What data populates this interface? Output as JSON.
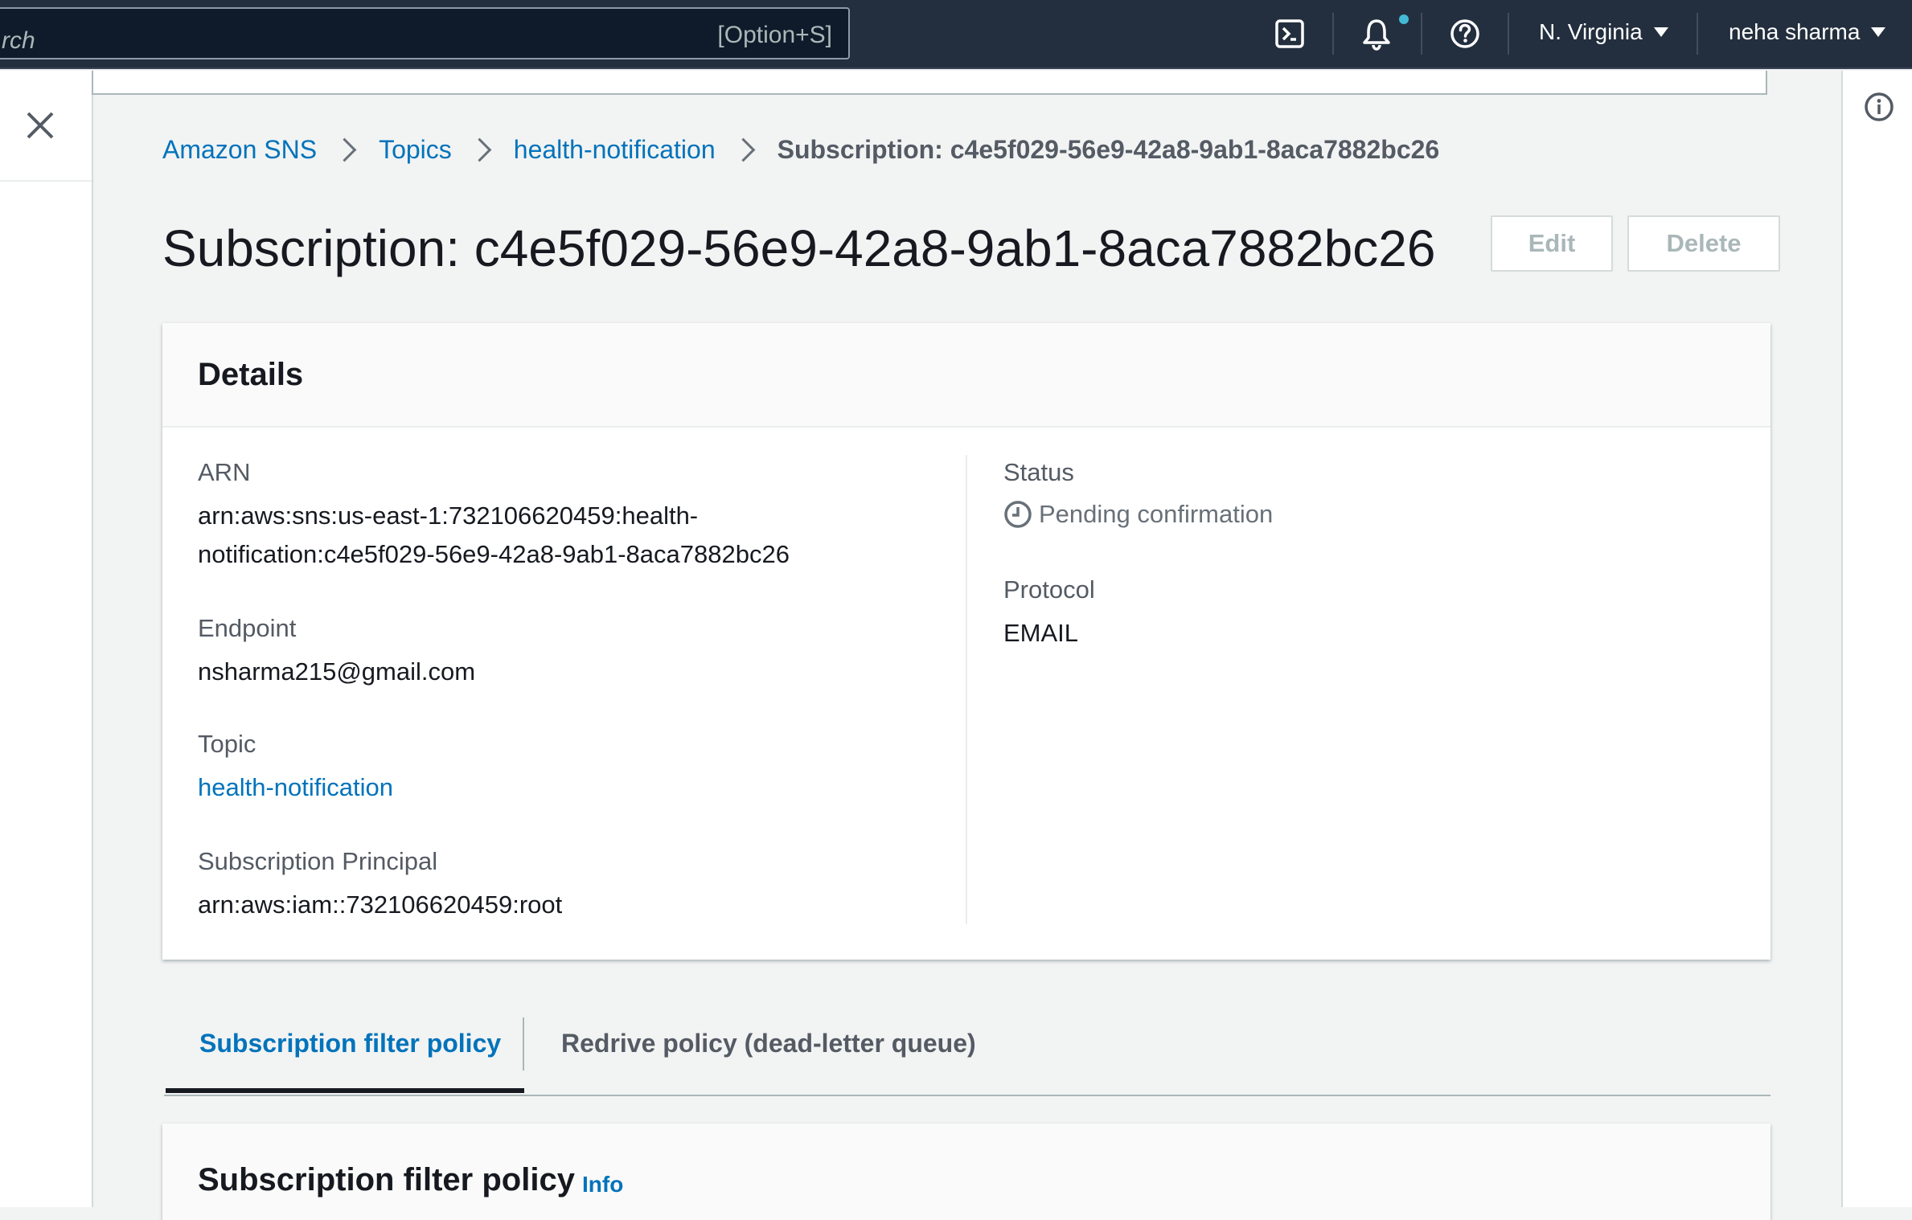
{
  "topnav": {
    "search_value": "rch",
    "search_shortcut": "[Option+S]",
    "region": "N. Virginia",
    "user": "neha sharma",
    "icons": [
      "cloudshell-icon",
      "bell-icon",
      "help-icon"
    ],
    "notification_dot_color": "#44b9d6"
  },
  "breadcrumb": {
    "items": [
      "Amazon SNS",
      "Topics",
      "health-notification"
    ],
    "current": "Subscription: c4e5f029-56e9-42a8-9ab1-8aca7882bc26"
  },
  "page": {
    "title": "Subscription: c4e5f029-56e9-42a8-9ab1-8aca7882bc26",
    "edit_label": "Edit",
    "delete_label": "Delete"
  },
  "details": {
    "heading": "Details",
    "arn_label": "ARN",
    "arn_line1": "arn:aws:sns:us-east-1:732106620459:health-",
    "arn_line2": "notification:c4e5f029-56e9-42a8-9ab1-8aca7882bc26",
    "endpoint_label": "Endpoint",
    "endpoint_value": "nsharma215@gmail.com",
    "topic_label": "Topic",
    "topic_value": "health-notification",
    "principal_label": "Subscription Principal",
    "principal_value": "arn:aws:iam::732106620459:root",
    "status_label": "Status",
    "status_value": "Pending confirmation",
    "protocol_label": "Protocol",
    "protocol_value": "EMAIL"
  },
  "tabs": {
    "items": [
      "Subscription filter policy",
      "Redrive policy (dead-letter queue)"
    ],
    "active": "Subscription filter policy"
  },
  "filter_policy": {
    "heading": "Subscription filter policy",
    "info_label": "Info"
  },
  "colors": {
    "link": "#0073bb",
    "nav_bg": "#232f3e",
    "page_bg": "#f2f3f3"
  }
}
